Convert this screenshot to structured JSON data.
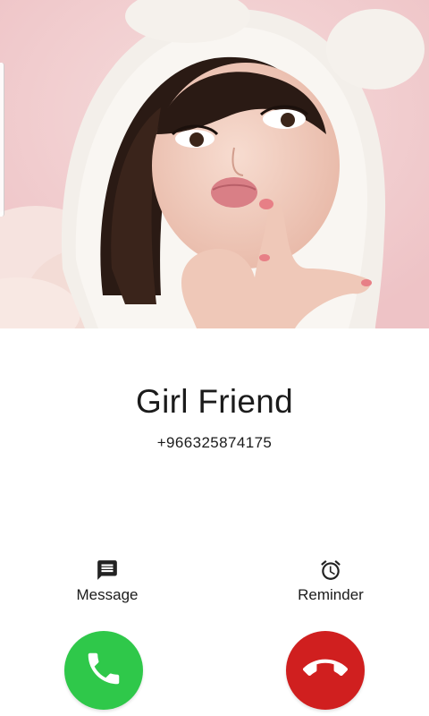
{
  "caller": {
    "name": "Girl Friend",
    "number": "+966325874175"
  },
  "actions": {
    "message": {
      "label": "Message",
      "icon": "message-icon"
    },
    "reminder": {
      "label": "Reminder",
      "icon": "alarm-clock-icon"
    }
  },
  "buttons": {
    "answer": {
      "icon": "phone-icon",
      "color": "#2fc84a"
    },
    "decline": {
      "icon": "phone-hangup-icon",
      "color": "#d01f1f"
    }
  }
}
